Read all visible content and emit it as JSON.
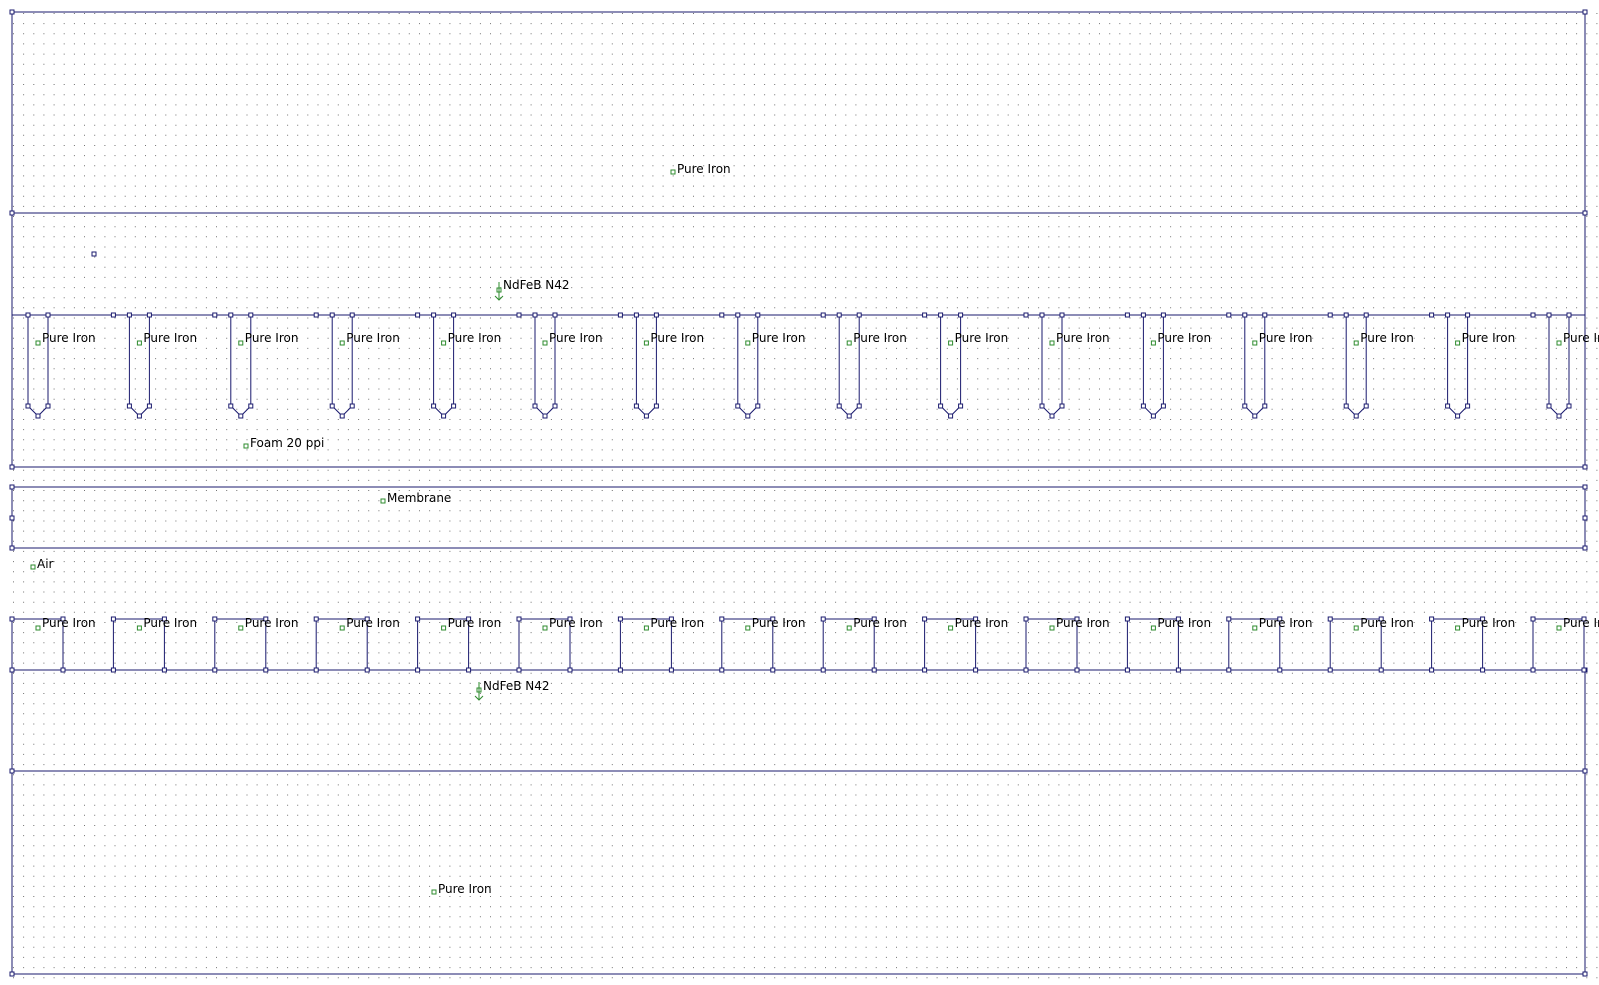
{
  "colors": {
    "background": "#ffffff",
    "grid_dot": "#000000",
    "geometry_line": "#1a1a6e",
    "node": "#1a1a6e",
    "label_marker": "#2e8b2e",
    "label_text": "#000000"
  },
  "labels": {
    "top_yoke": "Pure Iron",
    "upper_magnet": "NdFeB N42",
    "upper_foam": "Foam 20 ppi",
    "membrane": "Membrane",
    "air": "Air",
    "lower_magnet": "NdFeB N42",
    "bottom_yoke": "Pure Iron"
  },
  "upper_teeth": {
    "label": "Pure Iron",
    "count": 16
  },
  "lower_teeth": {
    "label": "Pure Iron",
    "count": 16
  },
  "magnetization": {
    "upper": "down",
    "lower": "down"
  }
}
